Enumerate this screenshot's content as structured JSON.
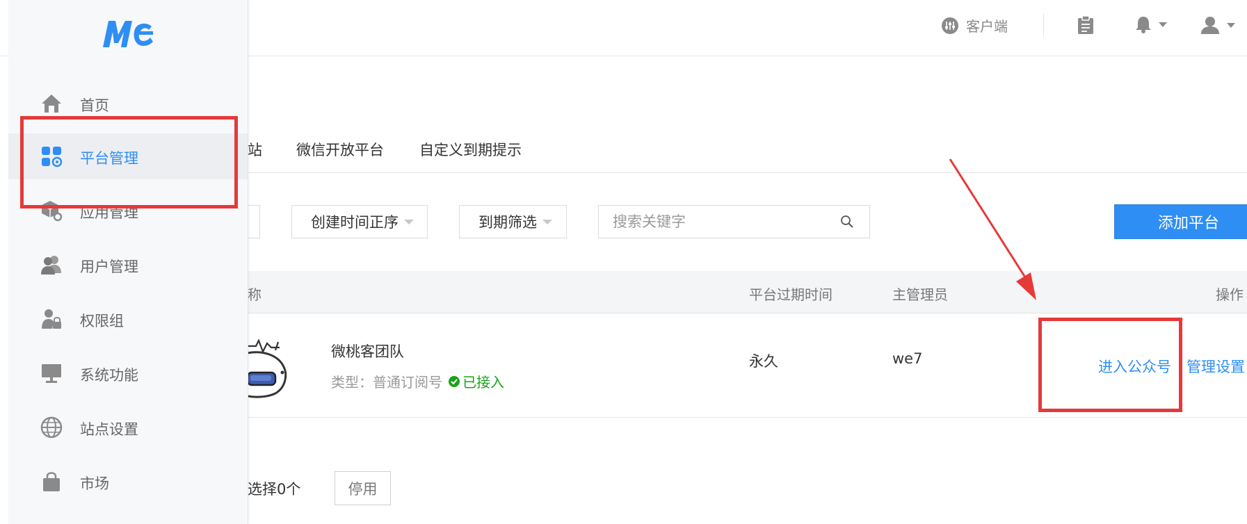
{
  "header": {
    "client_label": "客户端"
  },
  "sidebar": {
    "items": [
      {
        "label": "首页",
        "icon": "home-icon"
      },
      {
        "label": "平台管理",
        "icon": "platform-grid-icon"
      },
      {
        "label": "应用管理",
        "icon": "app-cube-icon"
      },
      {
        "label": "用户管理",
        "icon": "users-icon"
      },
      {
        "label": "权限组",
        "icon": "user-lock-icon"
      },
      {
        "label": "系统功能",
        "icon": "monitor-icon"
      },
      {
        "label": "站点设置",
        "icon": "globe-icon"
      },
      {
        "label": "市场",
        "icon": "shopping-bag-icon"
      }
    ]
  },
  "tabs": [
    "站",
    "微信开放平台",
    "自定义到期提示"
  ],
  "filters": {
    "sort_label": "创建时间正序",
    "expire_label": "到期筛选",
    "search_placeholder": "搜索关键字",
    "add_label": "添加平台"
  },
  "table": {
    "headers": [
      "称",
      "平台过期时间",
      "主管理员",
      "操作"
    ],
    "rows": [
      {
        "name": "微桃客团队",
        "type_label": "类型：普通订阅号",
        "status": "已接入",
        "expire": "永久",
        "admin": "we7",
        "action_enter": "进入公众号",
        "action_manage": "管理设置"
      }
    ]
  },
  "footer": {
    "selected_text": "选择0个",
    "stop_label": "停用"
  },
  "colors": {
    "accent": "#2f8ef3",
    "annotation": "#e6393a",
    "success": "#1aa31a"
  }
}
